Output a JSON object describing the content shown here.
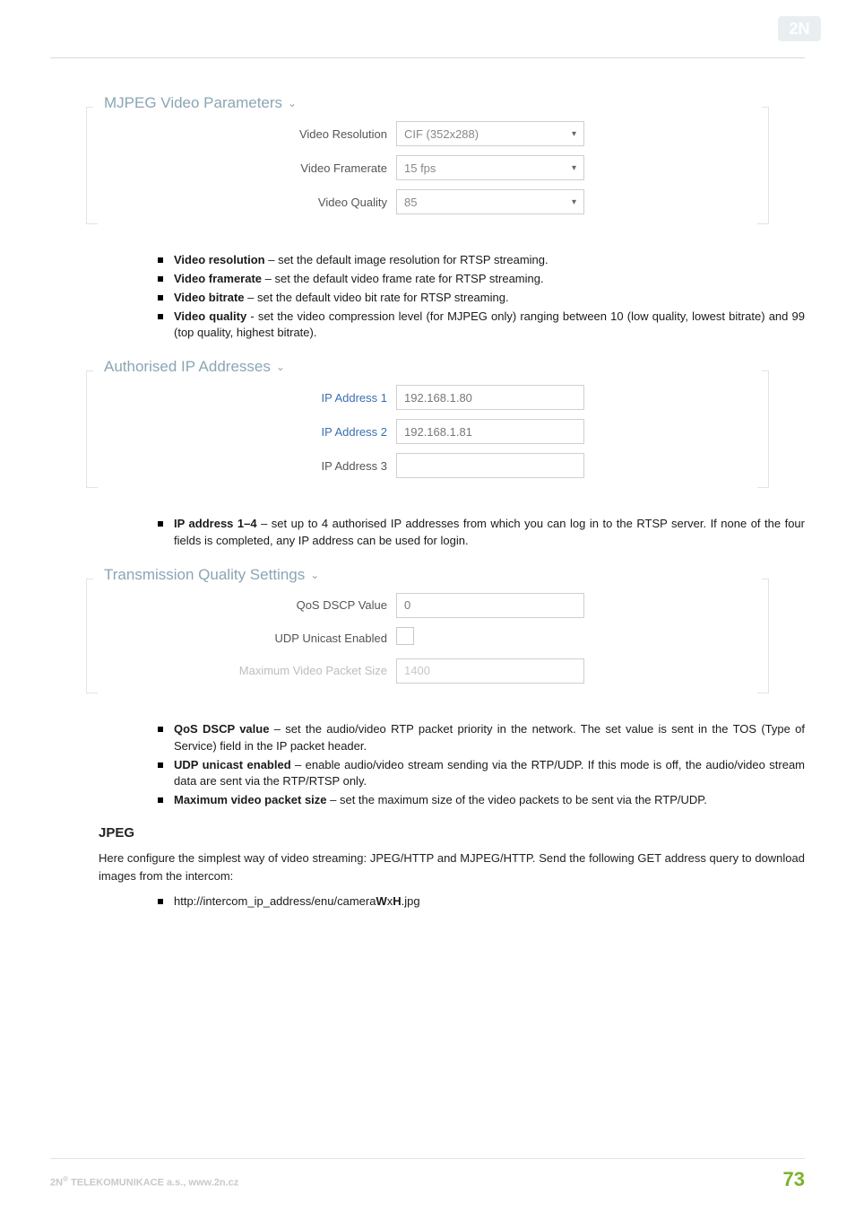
{
  "logo_text": "2N",
  "section1": {
    "legend": "MJPEG Video Parameters",
    "rows": {
      "resolution_label": "Video Resolution",
      "resolution_value": "CIF (352x288)",
      "framerate_label": "Video Framerate",
      "framerate_value": "15 fps",
      "quality_label": "Video Quality",
      "quality_value": "85"
    }
  },
  "bullets1": {
    "b1_term": "Video resolution",
    "b1_rest": " – set the default image resolution for RTSP streaming.",
    "b2_term": "Video framerate",
    "b2_rest": " – set the default video frame rate for RTSP streaming.",
    "b3_term": "Video bitrate",
    "b3_rest": " – set the default video bit rate for RTSP streaming.",
    "b4_term": "Video quality",
    "b4_rest": " - set the video compression level (for MJPEG only) ranging between 10 (low quality, lowest bitrate) and 99 (top quality, highest bitrate)."
  },
  "section2": {
    "legend": "Authorised IP Addresses",
    "rows": {
      "ip1_label": "IP Address 1",
      "ip1_value": "192.168.1.80",
      "ip2_label": "IP Address 2",
      "ip2_value": "192.168.1.81",
      "ip3_label": "IP Address 3",
      "ip3_value": ""
    }
  },
  "bullets2": {
    "b1_term": "IP address 1–4",
    "b1_rest": " – set up to 4 authorised IP addresses from which you can log in to the RTSP server. If none of the four fields is completed, any IP address can be used for login."
  },
  "section3": {
    "legend": "Transmission Quality Settings",
    "rows": {
      "dscp_label": "QoS DSCP Value",
      "dscp_value": "0",
      "udp_label": "UDP Unicast Enabled",
      "pkt_label": "Maximum Video Packet Size",
      "pkt_value": "1400"
    }
  },
  "bullets3": {
    "b1_term": "QoS DSCP value",
    "b1_rest": " – set the audio/video RTP packet priority in the network. The set value is sent in the TOS (Type of Service) field in the IP packet header.",
    "b2_term": "UDP unicast enabled",
    "b2_rest": " – enable audio/video stream sending via the RTP/UDP. If this mode is off, the audio/video stream data are sent via the RTP/RTSP only.",
    "b3_term": "Maximum video packet size",
    "b3_rest": " – set the maximum size of the video packets to be sent via the RTP/UDP."
  },
  "jpeg": {
    "heading": "JPEG",
    "para": "Here configure the simplest way of video streaming: JPEG/HTTP and MJPEG/HTTP. Send the following GET address query to download images from the intercom:",
    "url_pre": "http://intercom_ip_address/enu/camera",
    "url_w": "W",
    "url_x": "x",
    "url_h": "H",
    "url_post": ".jpg"
  },
  "footer": {
    "left_pre": "2N",
    "left_sup": "®",
    "left_post": " TELEKOMUNIKACE a.s., www.2n.cz",
    "page": "73"
  }
}
